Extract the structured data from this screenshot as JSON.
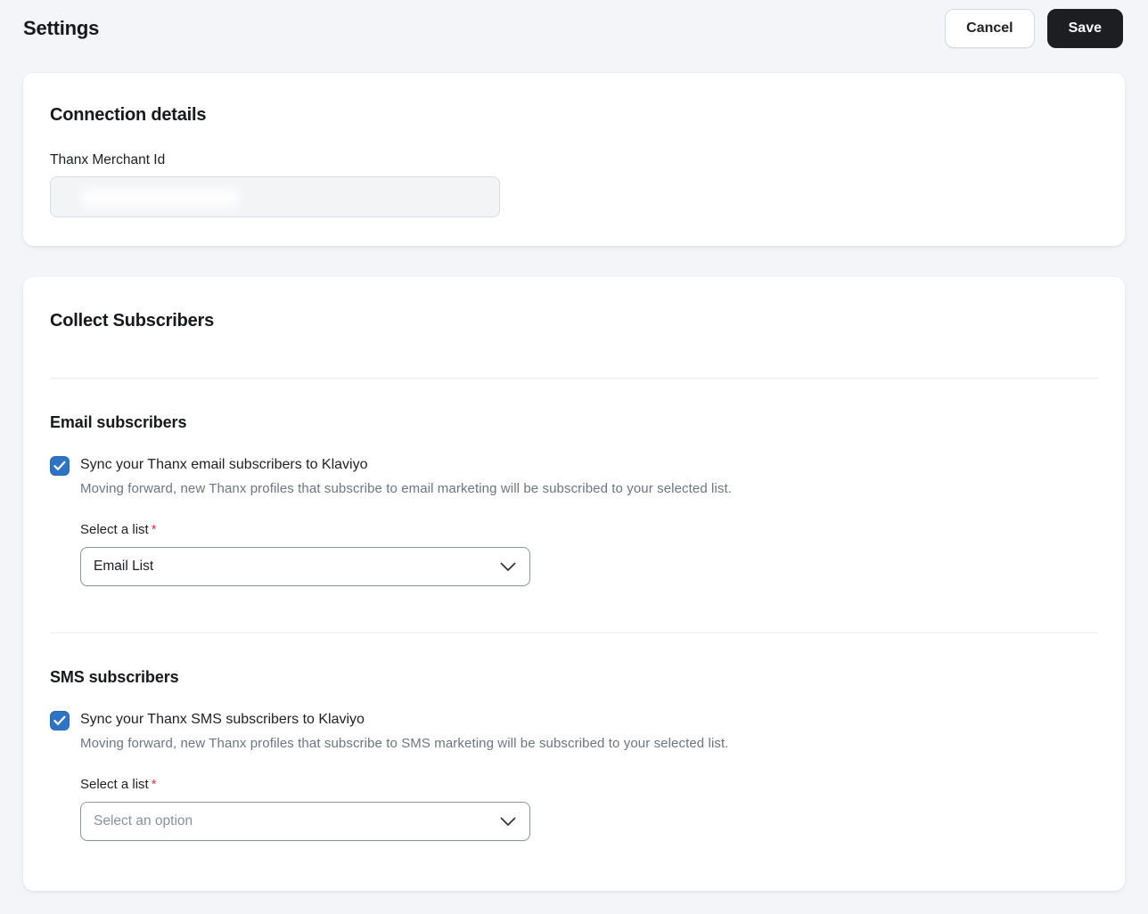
{
  "header": {
    "title": "Settings",
    "cancel_label": "Cancel",
    "save_label": "Save"
  },
  "connection_card": {
    "title": "Connection details",
    "merchant_id": {
      "label": "Thanx Merchant Id",
      "value_redacted": true
    }
  },
  "subscribers_card": {
    "title": "Collect Subscribers",
    "email_section": {
      "heading": "Email subscribers",
      "checkbox": {
        "checked": true,
        "label": "Sync your Thanx email subscribers to Klaviyo"
      },
      "description": "Moving forward, new Thanx profiles that subscribe to email marketing will be subscribed to your selected list.",
      "list_field": {
        "label": "Select a list",
        "required_marker": "*",
        "value": "Email List"
      }
    },
    "sms_section": {
      "heading": "SMS subscribers",
      "checkbox": {
        "checked": true,
        "label": "Sync your Thanx SMS subscribers to Klaviyo"
      },
      "description": "Moving forward, new Thanx profiles that subscribe to SMS marketing will be subscribed to your selected list.",
      "list_field": {
        "label": "Select a list",
        "required_marker": "*",
        "placeholder": "Select an option"
      }
    }
  },
  "colors": {
    "page_background": "#f4f5f8",
    "checkbox_blue": "#2e73c4",
    "required_red": "#d13b3b",
    "save_button_bg": "#1d1e21",
    "divider": "#ededf0"
  }
}
